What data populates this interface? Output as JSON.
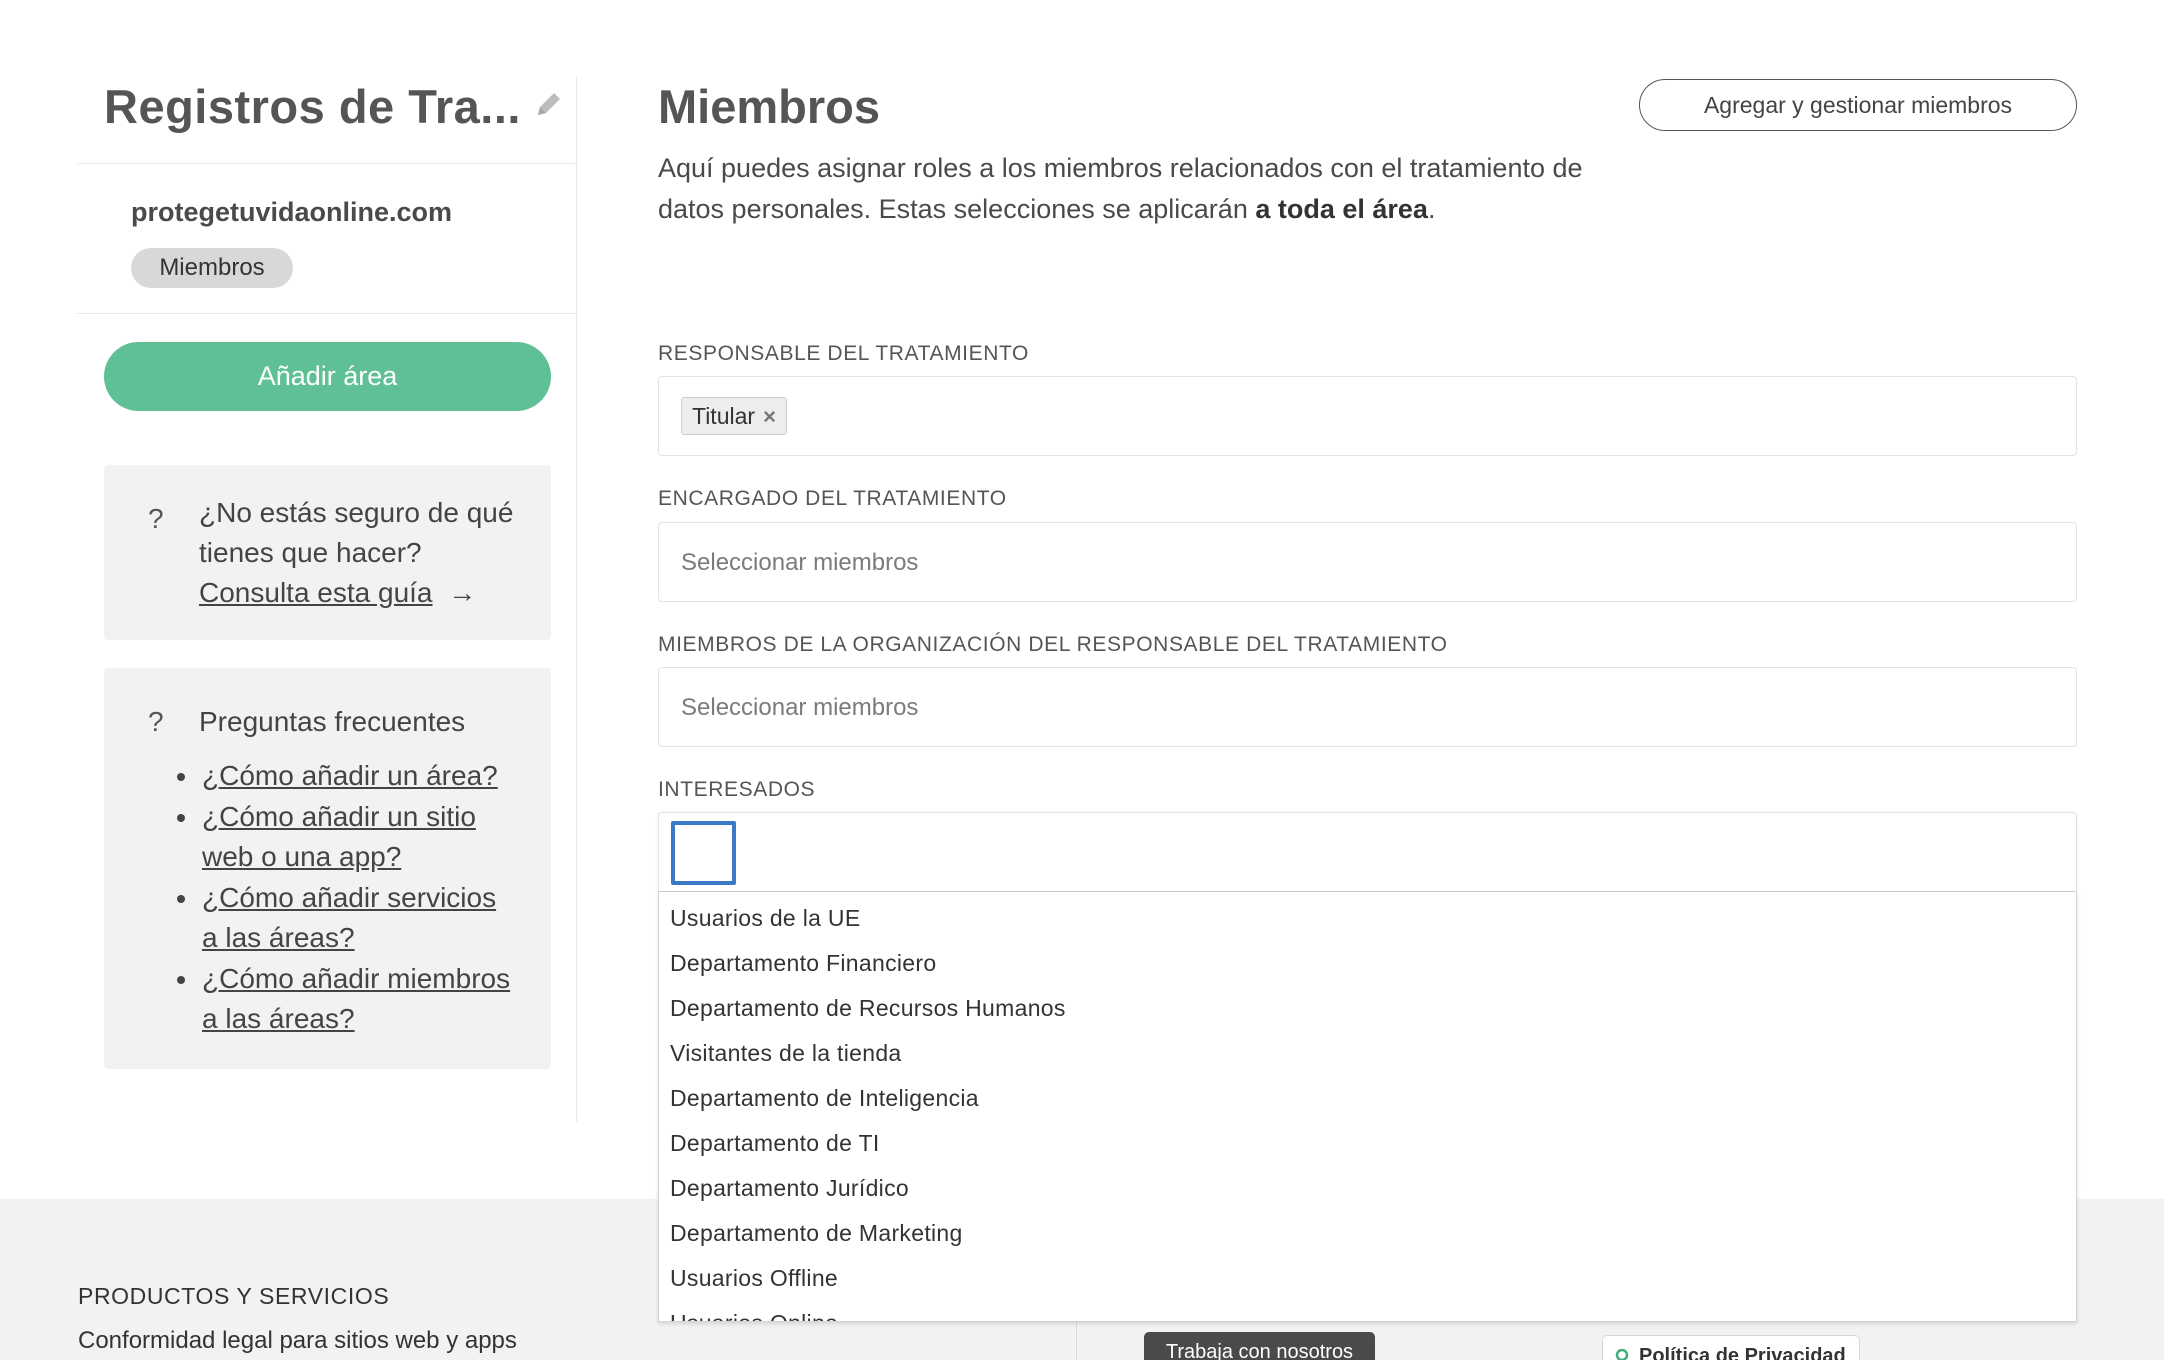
{
  "sidebar": {
    "title": "Registros de Tra...",
    "edit_icon": "pencil-icon",
    "site": "protegetuvidaonline.com",
    "badge": "Miembros",
    "add_area_label": "Añadir área",
    "help": {
      "icon": "question-icon",
      "text": "¿No estás seguro de qué tienes que hacer?",
      "link": "Consulta esta guía",
      "link_arrow": "→"
    },
    "faq": {
      "icon": "question-icon",
      "title": "Preguntas frecuentes",
      "items": [
        "¿Cómo añadir un área?",
        "¿Cómo añadir un sitio web o una app?",
        "¿Cómo añadir servicios a las áreas?",
        "¿Cómo añadir miembros a las áreas?"
      ]
    }
  },
  "main": {
    "title": "Miembros",
    "manage_button": "Agregar y gestionar miembros",
    "description_prefix": "Aquí puedes asignar roles a los miembros relacionados con el tratamiento de datos personales. Estas selecciones se aplicarán ",
    "description_bold": "a toda el área",
    "description_suffix": ".",
    "fields": [
      {
        "label": "RESPONSABLE DEL TRATAMIENTO",
        "tags": [
          "Titular"
        ],
        "tag_remove": "×"
      },
      {
        "label": "ENCARGADO DEL TRATAMIENTO",
        "placeholder": "Seleccionar miembros"
      },
      {
        "label": "MIEMBROS DE LA ORGANIZACIÓN DEL RESPONSABLE DEL TRATAMIENTO",
        "placeholder": "Seleccionar miembros"
      },
      {
        "label": "INTERESADOS",
        "value": ""
      }
    ],
    "dropdown_options": [
      "Usuarios de la UE",
      "Departamento Financiero",
      "Departamento de Recursos Humanos",
      "Visitantes de la tienda",
      "Departamento de Inteligencia",
      "Departamento de TI",
      "Departamento Jurídico",
      "Departamento de Marketing",
      "Usuarios Offline",
      "Usuarios Online"
    ]
  },
  "footer": {
    "heading": "PRODUCTOS Y SERVICIOS",
    "text": "Conformidad legal para sitios web y apps",
    "careers_button": "Trabaja con nosotros",
    "privacy_badge": "Política de Privacidad",
    "privacy_icon": "ribbon-icon"
  },
  "colors": {
    "accent_green": "#5ec094",
    "focus_blue": "#3b78c7",
    "panel_gray": "#f2f2f2"
  }
}
